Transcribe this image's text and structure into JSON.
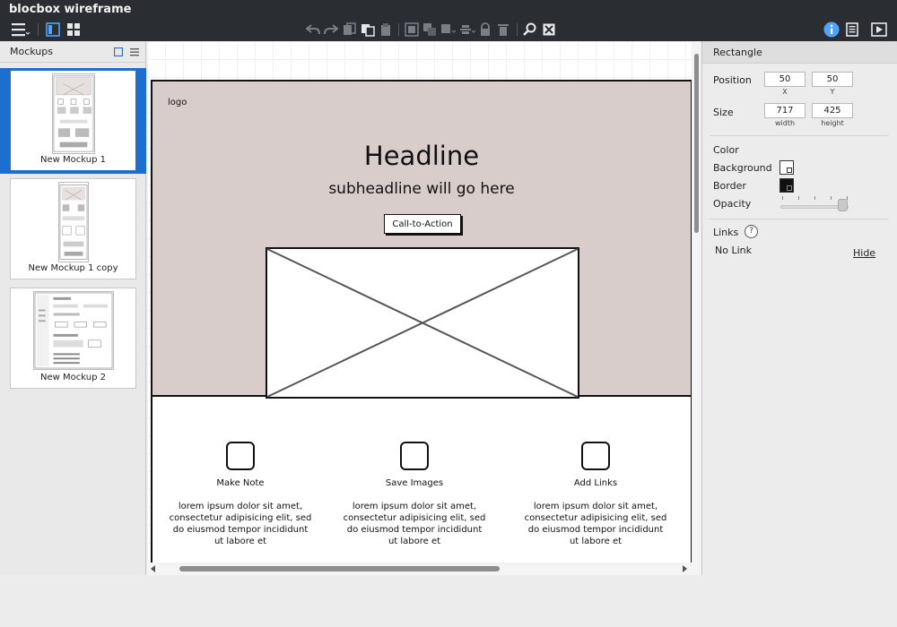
{
  "app": {
    "title": "blocbox wireframe"
  },
  "mockups_panel": {
    "title": "Mockups",
    "items": [
      {
        "label": "New Mockup 1",
        "selected": true
      },
      {
        "label": "New Mockup 1 copy",
        "selected": false
      },
      {
        "label": "New Mockup 2",
        "selected": false
      }
    ]
  },
  "wireframe": {
    "logo": "logo",
    "headline": "Headline",
    "subheadline": "subheadline will go here",
    "cta": "Call-to-Action",
    "hero_color": "#d8cdca",
    "features": [
      {
        "title": "Make Note",
        "text": "lorem ipsum dolor sit amet, consectetur adipisicing elit, sed do eiusmod tempor incididunt ut labore et"
      },
      {
        "title": "Save Images",
        "text": "lorem ipsum dolor sit amet, consectetur adipisicing elit, sed do eiusmod tempor incididunt ut labore et"
      },
      {
        "title": "Add Links",
        "text": "lorem ipsum dolor sit amet, consectetur adipisicing elit, sed do eiusmod tempor incididunt ut labore et"
      }
    ]
  },
  "properties": {
    "title": "Rectangle",
    "position_label": "Position",
    "position_x": "50",
    "position_y": "50",
    "x_label": "X",
    "y_label": "Y",
    "size_label": "Size",
    "width": "717",
    "height": "425",
    "width_label": "width",
    "height_label": "height",
    "color_label": "Color",
    "background_label": "Background",
    "border_label": "Border",
    "opacity_label": "Opacity",
    "links_label": "Links",
    "help_glyph": "?",
    "link_value": "No Link",
    "hide_label": "Hide",
    "accent_color": "#1c6fd1"
  }
}
